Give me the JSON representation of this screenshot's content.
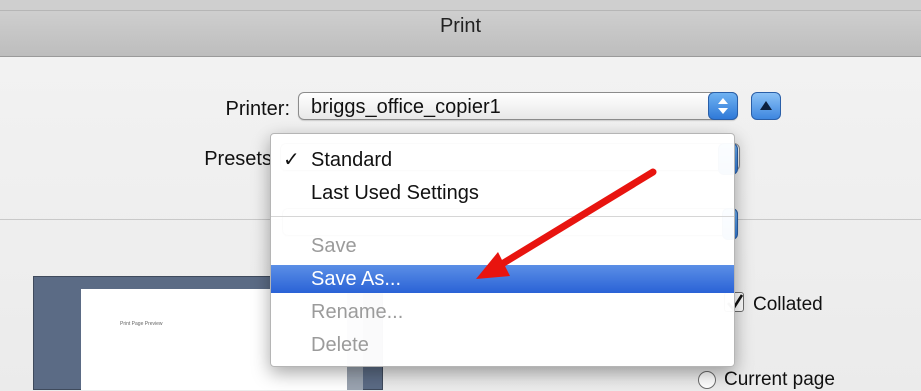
{
  "window": {
    "title": "Print"
  },
  "printer": {
    "label": "Printer:",
    "value": "briggs_office_copier1"
  },
  "presets": {
    "label": "Presets",
    "menu": [
      {
        "label": "Standard",
        "checked": true,
        "enabled": true,
        "highlighted": false
      },
      {
        "label": "Last Used Settings",
        "checked": false,
        "enabled": true,
        "highlighted": false
      },
      {
        "label": "Save",
        "checked": false,
        "enabled": false,
        "highlighted": false
      },
      {
        "label": "Save As...",
        "checked": false,
        "enabled": true,
        "highlighted": true
      },
      {
        "label": "Rename...",
        "checked": false,
        "enabled": false,
        "highlighted": false
      },
      {
        "label": "Delete",
        "checked": false,
        "enabled": false,
        "highlighted": false
      }
    ],
    "check_glyph": "✓"
  },
  "options": {
    "collated_label": "Collated",
    "collated_checked": true,
    "current_page_label": "Current page"
  },
  "preview": {
    "text": "Print Page Preview"
  },
  "colors": {
    "highlight": "#2a62d6",
    "annotation_arrow": "#e8140f",
    "stepper": "#3a82dc"
  },
  "icons": {
    "popup_stepper": "up-down-stepper-icon",
    "disclosure": "triangle-up-icon",
    "checkmark": "checkmark-icon",
    "annotation": "red-arrow-annotation"
  }
}
